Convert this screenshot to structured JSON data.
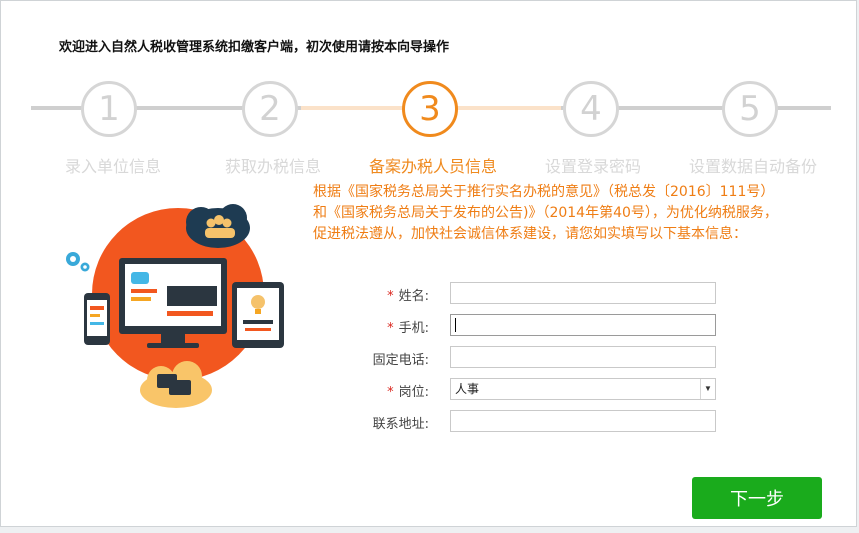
{
  "header": {
    "title": "欢迎进入自然人税收管理系统扣缴客户端，初次使用请按本向导操作"
  },
  "steps": [
    {
      "number": "1",
      "label": "录入单位信息",
      "state": "inactive"
    },
    {
      "number": "2",
      "label": "获取办税信息",
      "state": "inactive"
    },
    {
      "number": "3",
      "label": "备案办税人员信息",
      "state": "active"
    },
    {
      "number": "4",
      "label": "设置登录密码",
      "state": "inactive"
    },
    {
      "number": "5",
      "label": "设置数据自动备份",
      "state": "inactive"
    }
  ],
  "notice": "根据《国家税务总局关于推行实名办税的意见》（税总发〔2016〕111号）和《国家税务总局关于发布的公告)》（2014年第40号），为优化纳税服务，促进税法遵从，加快社会诚信体系建设，请您如实填写以下基本信息：",
  "form": {
    "required_mark": "*",
    "name": {
      "label": "姓名:",
      "value": ""
    },
    "phone": {
      "label": "手机:",
      "value": ""
    },
    "landline": {
      "label": "固定电话:",
      "value": ""
    },
    "position": {
      "label": "岗位:",
      "value": "人事"
    },
    "address": {
      "label": "联系地址:",
      "value": ""
    }
  },
  "footer": {
    "next_label": "下一步"
  },
  "colors": {
    "accent": "#f08a1d",
    "primary_button": "#1aab1c",
    "required": "#d9251d"
  },
  "icons": [
    "cloud-people-icon",
    "gear-icon",
    "monitor-icon",
    "phone-icon",
    "tablet-icon",
    "lightbulb-icon",
    "chat-cloud-icon",
    "chevron-down-icon"
  ]
}
